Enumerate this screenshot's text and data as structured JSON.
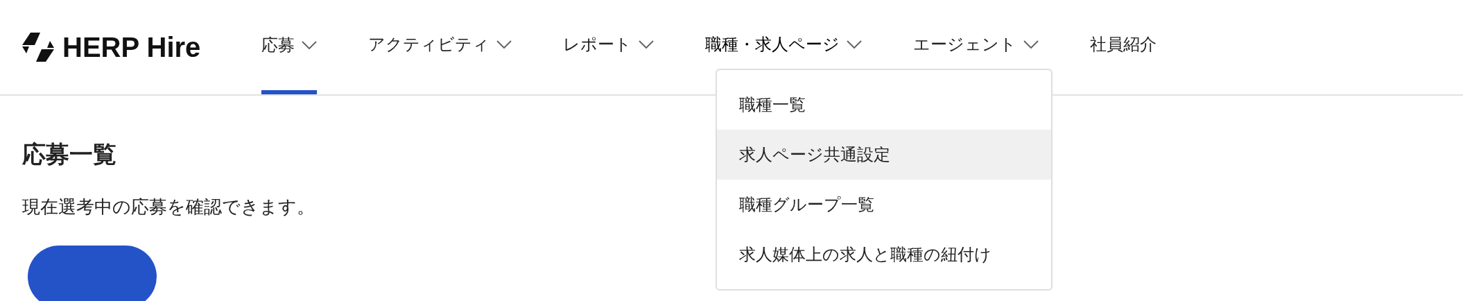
{
  "logo": {
    "text": "HERP Hire"
  },
  "nav": [
    {
      "label": "応募",
      "kind": "menu",
      "selected": true,
      "expanded": false
    },
    {
      "label": "アクティビティ",
      "kind": "menu",
      "selected": false,
      "expanded": false
    },
    {
      "label": "レポート",
      "kind": "menu",
      "selected": false,
      "expanded": false
    },
    {
      "label": "職種・求人ページ",
      "kind": "menu",
      "selected": false,
      "expanded": true
    },
    {
      "label": "エージェント",
      "kind": "menu",
      "selected": false,
      "expanded": false
    },
    {
      "label": "社員紹介",
      "kind": "link",
      "selected": false,
      "expanded": false
    }
  ],
  "dropdown": [
    {
      "label": "職種一覧",
      "hovered": false
    },
    {
      "label": "求人ページ共通設定",
      "hovered": true
    },
    {
      "label": "職種グループ一覧",
      "hovered": false
    },
    {
      "label": "求人媒体上の求人と職種の紐付け",
      "hovered": false
    }
  ],
  "page": {
    "title": "応募一覧",
    "description": "現在選考中の応募を確認できます。"
  }
}
